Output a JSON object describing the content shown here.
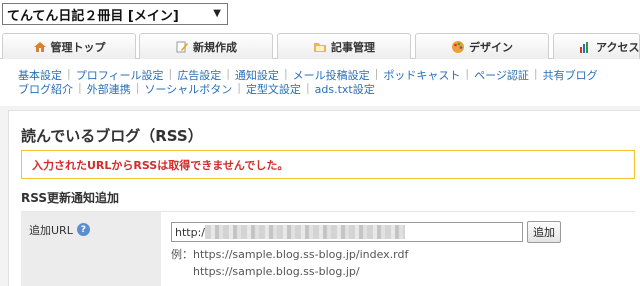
{
  "blog_selector": {
    "value": "てんてん日記２冊目 [メイン]"
  },
  "tabs": [
    {
      "label": "管理トップ",
      "icon": "home-icon"
    },
    {
      "label": "新規作成",
      "icon": "pencil-icon"
    },
    {
      "label": "記事管理",
      "icon": "folder-icon"
    },
    {
      "label": "デザイン",
      "icon": "palette-icon"
    },
    {
      "label": "アクセス解",
      "icon": "chart-icon"
    }
  ],
  "subnav": {
    "row1": [
      "基本設定",
      "プロフィール設定",
      "広告設定",
      "通知設定",
      "メール投稿設定",
      "ポッドキャスト",
      "ページ認証",
      "共有ブログ"
    ],
    "row2": [
      "ブログ紹介",
      "外部連携",
      "ソーシャルボタン",
      "定型文設定",
      "ads.txt設定"
    ]
  },
  "page": {
    "title": "読んでいるブログ（RSS）",
    "error_message": "入力されたURLからRSSは取得できませんでした。",
    "section_title": "RSS更新通知追加"
  },
  "form": {
    "label": "追加URL",
    "help_icon": "question-icon",
    "input_value": "http:/",
    "add_button": "追加",
    "example_line1": "例：https://sample.blog.ss-blog.jp/index.rdf",
    "example_line2": "https://sample.blog.ss-blog.jp/"
  },
  "colors": {
    "link": "#2a6fb7",
    "error": "#d42b2b",
    "error_border": "#f1c232"
  }
}
